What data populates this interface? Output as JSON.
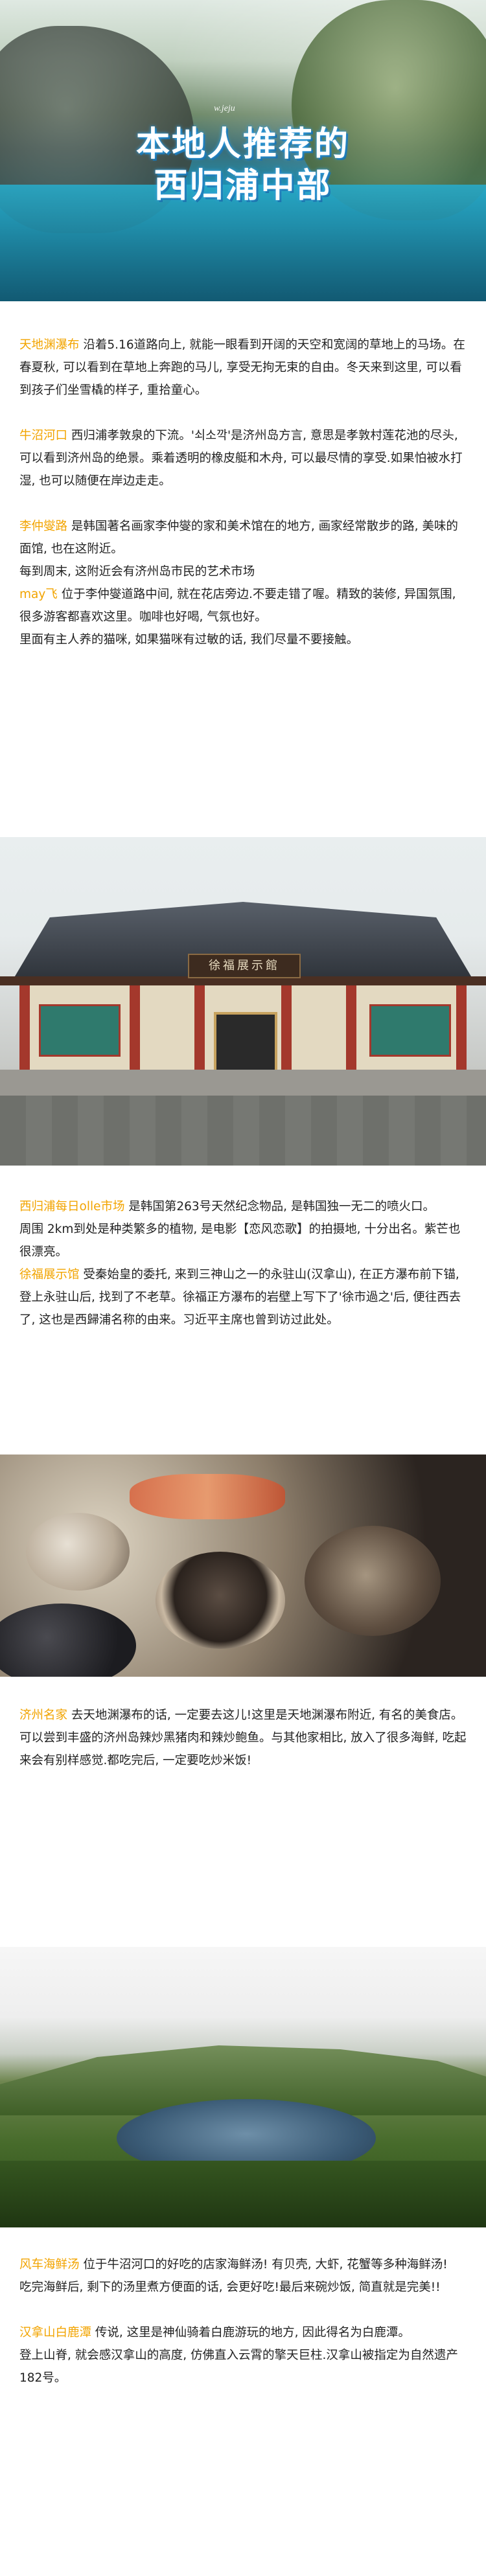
{
  "hero": {
    "small_text": "w.jeju",
    "title_line1": "本地人推荐的",
    "title_line2": "西归浦中部"
  },
  "sections": {
    "s1": {
      "name": "天地渊瀑布",
      "text": " 沿着5.16道路向上, 就能一眼看到开阔的天空和宽阔的草地上的马场。在春夏秋, 可以看到在草地上奔跑的马儿, 享受无拘无束的自由。冬天来到这里, 可以看到孩子们坐雪橇的样子, 重拾童心。"
    },
    "s2": {
      "name": "牛沼河口",
      "text": " 西归浦孝敦泉的下流。'쇠소깍'是济州岛方言, 意思是孝敦村莲花池的尽头, 可以看到济州岛的绝景。乘着透明的橡皮艇和木舟, 可以最尽情的享受.如果怕被水打湿, 也可以随便在岸边走走。"
    },
    "s3": {
      "name": "李仲燮路",
      "text": " 是韩国著名画家李仲燮的家和美术馆在的地方, 画家经常散步的路, 美味的面馆, 也在这附近。",
      "line2": "每到周末, 这附近会有济州岛市民的艺术市场",
      "name2": "may飞",
      "text2": " 位于李仲燮道路中间, 就在花店旁边.不要走错了喔。精致的装修, 异国氛围, 很多游客都喜欢这里。咖啡也好喝, 气氛也好。",
      "line3": "里面有主人养的猫咪, 如果猫咪有过敏的话, 我们尽量不要接触。"
    },
    "museum_photo": {
      "sign_text": "徐福展示館"
    },
    "s4": {
      "name": "西归浦每日olle市场",
      "text": " 是韩国第263号天然纪念物品, 是韩国独一无二的喷火口。",
      "line2": "周围 2km到处是种类繁多的植物, 是电影【恋风恋歌】的拍摄地, 十分出名。紫芒也很漂亮。",
      "name2": "徐福展示馆",
      "text2": " 受秦始皇的委托, 来到三神山之一的永驻山(汉拿山), 在正方瀑布前下锚, 登上永驻山后, 找到了不老草。徐福正方瀑布的岩壁上写下了'徐市過之'后, 便往西去了, 这也是西歸浦名称的由来。习近平主席也曾到访过此处。"
    },
    "s5": {
      "name": "济州名家",
      "text": " 去天地渊瀑布的话, 一定要去这儿!这里是天地渊瀑布附近, 有名的美食店。可以尝到丰盛的济州岛辣炒黑猪肉和辣炒鲍鱼。与其他家相比, 放入了很多海鲜, 吃起来会有别样感觉.都吃完后, 一定要吃炒米饭!"
    },
    "s6": {
      "name": "风车海鲜汤",
      "text": " 位于牛沼河口的好吃的店家海鲜汤! 有贝壳, 大虾, 花蟹等多种海鲜汤!",
      "line2": "吃完海鲜后, 剩下的汤里煮方便面的话, 会更好吃!最后来碗炒饭, 简直就是完美!!",
      "name2": "汉拿山白鹿潭",
      "text2": " 传说, 这里是神仙骑着白鹿游玩的地方, 因此得名为白鹿潭。",
      "line3": "登上山脊, 就会感汉拿山的高度, 仿佛直入云霄的擎天巨柱.汉拿山被指定为自然遗产182号。"
    }
  },
  "colors": {
    "highlight": "#f2a400",
    "body_text": "#222222",
    "title_glow": "#39a7e6"
  }
}
